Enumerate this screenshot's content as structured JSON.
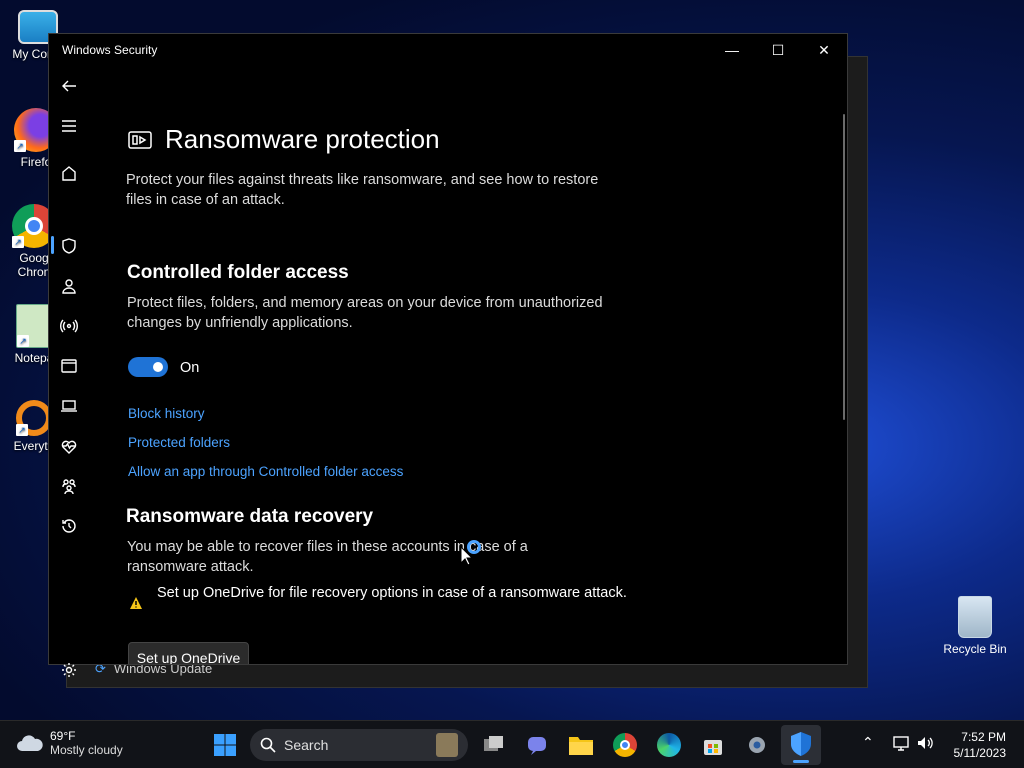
{
  "desktop": {
    "icons": [
      {
        "label": "My Comp"
      },
      {
        "label": "Firefo"
      },
      {
        "label": "Goog Chron"
      },
      {
        "label": "Notepa"
      },
      {
        "label": "Everyth"
      }
    ],
    "recycle_bin": "Recycle Bin",
    "back_window_item": "Windows Update"
  },
  "window": {
    "title": "Windows Security",
    "controls": {
      "minimize": "—",
      "maximize": "☐",
      "close": "✕"
    }
  },
  "sidebar": {
    "items": [
      "back-icon",
      "menu-icon",
      "home-icon",
      "shield-icon",
      "account-icon",
      "network-icon",
      "app-browser-icon",
      "device-security-icon",
      "device-health-icon",
      "family-icon",
      "history-icon",
      "settings-icon"
    ]
  },
  "page": {
    "title": "Ransomware protection",
    "description": "Protect your files against threats like ransomware, and see how to restore files in case of an attack.",
    "cfa": {
      "heading": "Controlled folder access",
      "description": "Protect files, folders, and memory areas on your device from unauthorized changes by unfriendly applications.",
      "toggle_state": "On",
      "toggle_on": true,
      "links": {
        "block_history": "Block history",
        "protected_folders": "Protected folders",
        "allow_app": "Allow an app through Controlled folder access"
      }
    },
    "recovery": {
      "heading": "Ransomware data recovery",
      "description": "You may be able to recover files in these accounts in case of a ransomware attack.",
      "warning": "Set up OneDrive for file recovery options in case of a ransomware attack.",
      "button": "Set up OneDrive"
    }
  },
  "taskbar": {
    "weather_temp": "69°F",
    "weather_desc": "Mostly cloudy",
    "search_label": "Search",
    "time": "7:52 PM",
    "date": "5/11/2023",
    "accent": "#4ca3ff"
  }
}
